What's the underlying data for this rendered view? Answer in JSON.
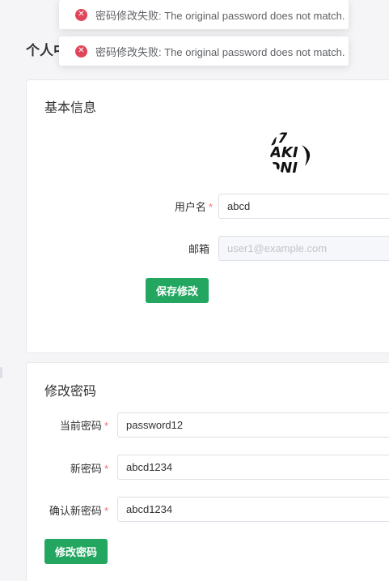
{
  "page": {
    "title": "个人中心"
  },
  "toasts": [
    {
      "icon": "error-icon",
      "message": "密码修改失败: The original password does not match."
    },
    {
      "icon": "error-icon",
      "message": "密码修改失败: The original password does not match."
    }
  ],
  "basic_info": {
    "title": "基本信息",
    "avatar_text": [
      "J7",
      "AKI",
      "ONI"
    ],
    "username_label": "用户名",
    "username_value": "abcd",
    "email_label": "邮箱",
    "email_placeholder": "user1@example.com",
    "save_label": "保存修改"
  },
  "password": {
    "title": "修改密码",
    "current_label": "当前密码",
    "current_value": "password12",
    "new_label": "新密码",
    "new_value": "abcd1234",
    "confirm_label": "确认新密码",
    "confirm_value": "abcd1234",
    "submit_label": "修改密码"
  },
  "required_mark": "*",
  "colors": {
    "primary": "#22a660",
    "error": "#e0455b",
    "required": "#f56c6c"
  }
}
